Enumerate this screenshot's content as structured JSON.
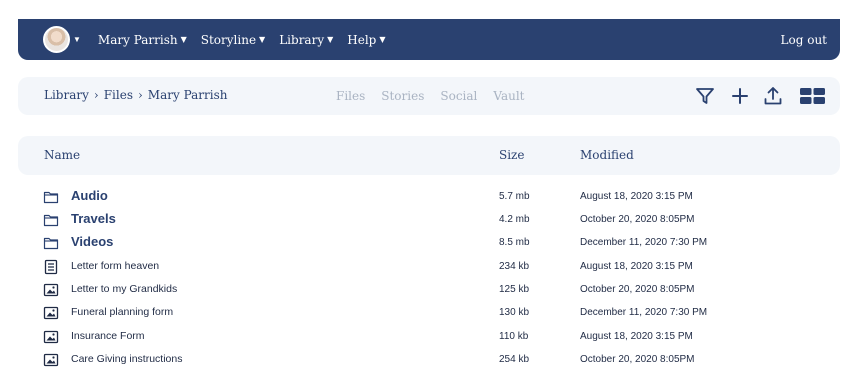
{
  "nav": {
    "items": [
      {
        "label": "Mary Parrish"
      },
      {
        "label": "Storyline"
      },
      {
        "label": "Library"
      },
      {
        "label": "Help"
      }
    ],
    "logout_label": "Log out"
  },
  "breadcrumb": {
    "items": [
      "Library",
      "Files",
      "Mary Parrish"
    ],
    "separator": "›"
  },
  "tabs": [
    "Files",
    "Stories",
    "Social",
    "Vault"
  ],
  "toolbar_icons": [
    "filter-icon",
    "add-icon",
    "upload-icon",
    "grid-view-icon"
  ],
  "table": {
    "headers": {
      "name": "Name",
      "size": "Size",
      "modified": "Modified"
    },
    "rows": [
      {
        "type": "folder",
        "icon": "folder-icon",
        "name": "Audio",
        "size": "5.7 mb",
        "modified": "August 18, 2020 3:15 PM"
      },
      {
        "type": "folder",
        "icon": "folder-icon",
        "name": "Travels",
        "size": "4.2 mb",
        "modified": "October 20, 2020 8:05PM"
      },
      {
        "type": "folder",
        "icon": "folder-icon",
        "name": "Videos",
        "size": "8.5 mb",
        "modified": "December 11, 2020 7:30 PM"
      },
      {
        "type": "document",
        "icon": "document-icon",
        "name": "Letter form heaven",
        "size": "234 kb",
        "modified": "August 18, 2020 3:15 PM"
      },
      {
        "type": "image",
        "icon": "image-icon",
        "name": "Letter to my Grandkids",
        "size": "125 kb",
        "modified": "October 20, 2020 8:05PM"
      },
      {
        "type": "image",
        "icon": "image-icon",
        "name": "Funeral planning form",
        "size": "130 kb",
        "modified": "December 11, 2020 7:30 PM"
      },
      {
        "type": "image",
        "icon": "image-icon",
        "name": "Insurance Form",
        "size": "110 kb",
        "modified": "August 18, 2020 3:15 PM"
      },
      {
        "type": "image",
        "icon": "image-icon",
        "name": "Care Giving instructions",
        "size": "254 kb",
        "modified": "October 20, 2020 8:05PM"
      }
    ]
  },
  "colors": {
    "brand": "#2a4170",
    "panel": "#f3f6fa",
    "muted_tab": "#a9b3c2"
  }
}
